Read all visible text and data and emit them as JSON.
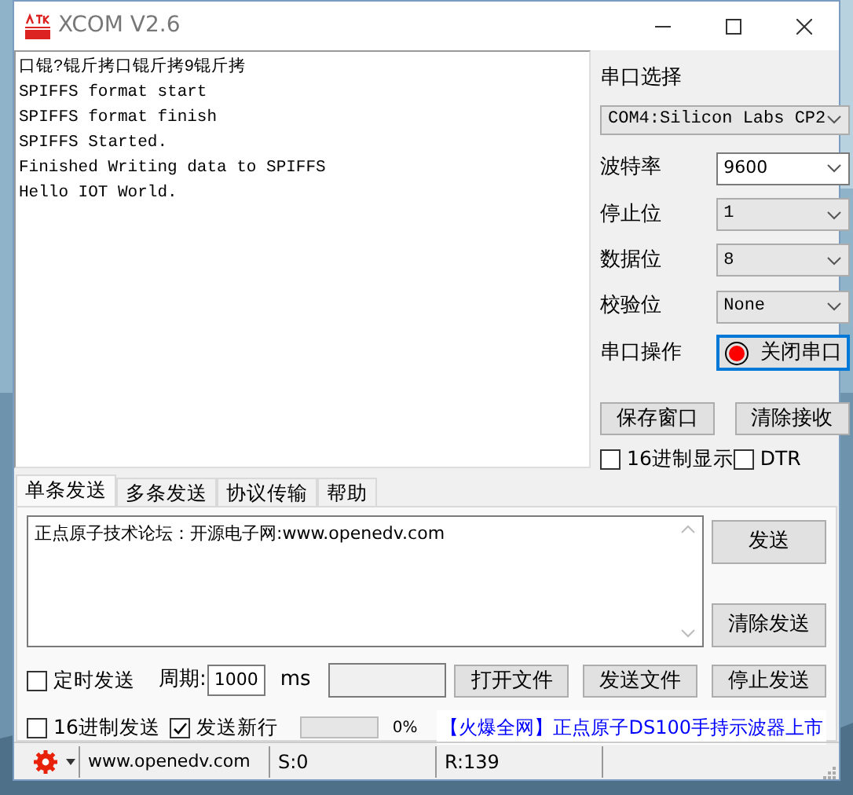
{
  "window": {
    "title": "XCOM V2.6"
  },
  "receive": {
    "lines": [
      "口锟?锟斤拷口锟斤拷9锟斤拷",
      "SPIFFS format start",
      "SPIFFS format finish",
      "SPIFFS Started.",
      "Finished Writing data to SPIFFS",
      "Hello IOT World."
    ]
  },
  "serial": {
    "port_label": "串口选择",
    "port": "COM4:Silicon Labs CP2",
    "settings": [
      {
        "label": "波特率",
        "value": "9600",
        "enabled": true
      },
      {
        "label": "停止位",
        "value": "1",
        "enabled": false
      },
      {
        "label": "数据位",
        "value": "8",
        "enabled": false
      },
      {
        "label": "校验位",
        "value": "None",
        "enabled": false
      }
    ],
    "operation_label": "串口操作",
    "operation_button": {
      "label": "关闭串口",
      "open": true
    },
    "buttons": [
      "保存窗口",
      "清除接收"
    ],
    "options": [
      {
        "label": "16进制显示",
        "checked": false
      },
      {
        "label": "DTR",
        "checked": false
      }
    ]
  },
  "tabs": [
    {
      "label": "单条发送",
      "selected": true
    },
    {
      "label": "多条发送",
      "selected": false
    },
    {
      "label": "协议传输",
      "selected": false
    },
    {
      "label": "帮助",
      "selected": false
    }
  ],
  "send": {
    "text": "正点原子技术论坛：开源电子网:www.openedv.com",
    "buttons": [
      "发送",
      "清除发送"
    ],
    "timed": {
      "label": "定时发送",
      "checked": false
    },
    "period_label": "周期:",
    "period": "1000",
    "unit": "ms",
    "file_buttons": [
      "打开文件",
      "发送文件",
      "停止发送"
    ],
    "options": [
      {
        "label": "16进制发送",
        "checked": false
      },
      {
        "label": "发送新行",
        "checked": true
      }
    ],
    "progress": {
      "level": 0,
      "reading": "0%"
    },
    "ad": "【火爆全网】正点原子DS100手持示波器上市"
  },
  "status_bar": {
    "site": "www.openedv.com",
    "sent": "S:0",
    "received": "R:139"
  }
}
